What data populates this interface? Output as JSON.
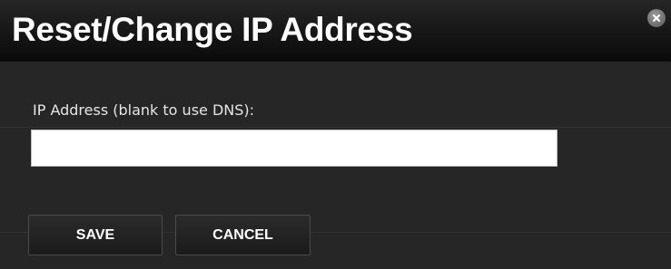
{
  "dialog": {
    "title": "Reset/Change IP Address",
    "close_icon": "close-circle-icon"
  },
  "form": {
    "ip_label": "IP Address (blank to use DNS):",
    "ip_value": "",
    "ip_placeholder": ""
  },
  "actions": {
    "save_label": "SAVE",
    "cancel_label": "CANCEL"
  },
  "colors": {
    "background": "#262626",
    "titlebar_dark": "#0a0a0a",
    "text": "#ffffff",
    "input_bg": "#ffffff"
  }
}
